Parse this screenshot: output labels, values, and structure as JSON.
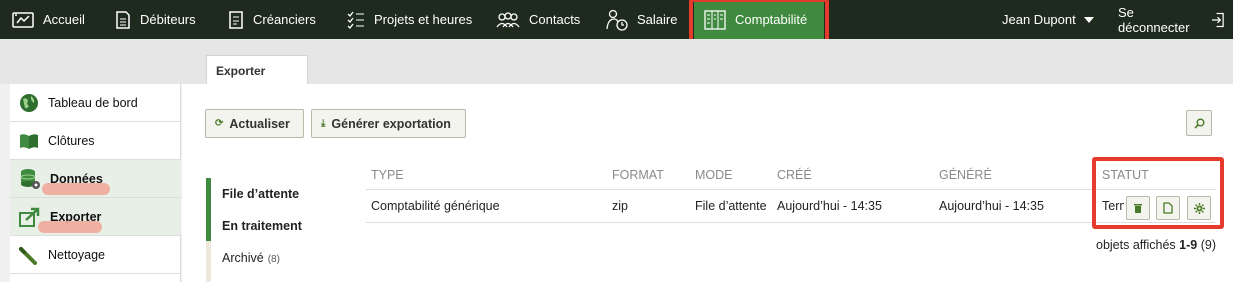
{
  "nav": {
    "items": [
      {
        "label": "Accueil",
        "icon": "dashboard-icon"
      },
      {
        "label": "Débiteurs",
        "icon": "document-icon"
      },
      {
        "label": "Créanciers",
        "icon": "invoice-icon"
      },
      {
        "label": "Projets et heures",
        "icon": "checklist-icon"
      },
      {
        "label": "Contacts",
        "icon": "people-icon"
      },
      {
        "label": "Salaire",
        "icon": "salary-icon"
      },
      {
        "label": "Comptabilité",
        "icon": "ledger-icon"
      }
    ],
    "user": "Jean Dupont",
    "logout": "Se déconnecter",
    "active_color": "#3f8a3f",
    "highlight_color": "#e53b2c"
  },
  "tabs": [
    "Exporter"
  ],
  "sidebar": {
    "items": [
      {
        "label": "Tableau de bord",
        "icon": "globe-icon"
      },
      {
        "label": "Clôtures",
        "icon": "book-icon"
      },
      {
        "label": "Données",
        "icon": "database-icon"
      },
      {
        "label": "Exporter",
        "icon": "export-icon"
      },
      {
        "label": "Nettoyage",
        "icon": "broom-icon"
      }
    ]
  },
  "toolbar": {
    "refresh": "Actualiser",
    "generate": "Générer exportation"
  },
  "status_filters": [
    {
      "label": "File d’attente",
      "count": ""
    },
    {
      "label": "En traitement",
      "count": ""
    },
    {
      "label": "Archivé",
      "count": "(8)"
    }
  ],
  "table": {
    "headers": [
      "TYPE",
      "FORMAT",
      "MODE",
      "CRÉÉ",
      "GÉNÉRÉ",
      "STATUT"
    ],
    "rows": [
      {
        "type": "Comptabilité générique",
        "format": "zip",
        "mode": "File d’attente",
        "created": "Aujourd’hui - 14:35",
        "generated": "Aujourd’hui - 14:35",
        "status": "Terminé"
      }
    ]
  },
  "summary": {
    "prefix": "objets affichés",
    "range": "1-9",
    "total": "(9)"
  }
}
